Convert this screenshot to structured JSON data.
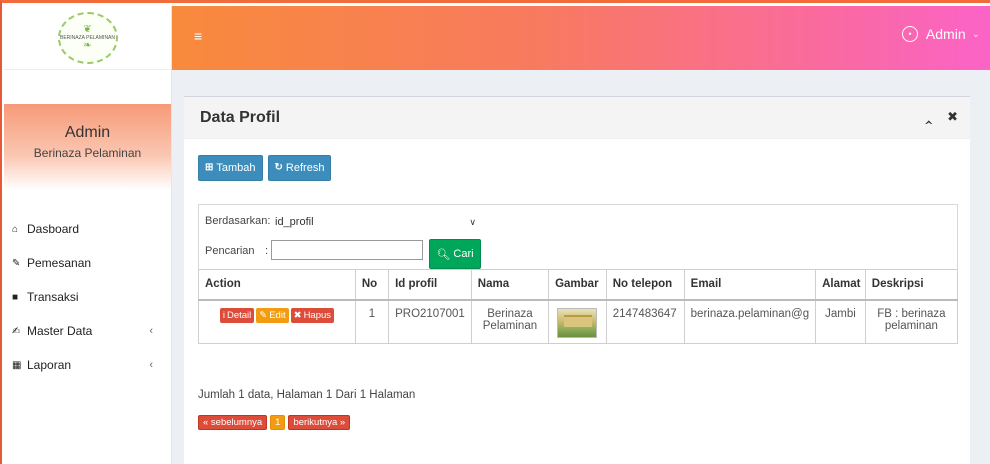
{
  "sidebar": {
    "logo_text": "BERINAZA PELAMINAN",
    "user_name": "Admin",
    "user_org": "Berinaza Pelaminan",
    "items": [
      {
        "label": "Dasboard"
      },
      {
        "label": "Pemesanan"
      },
      {
        "label": "Transaksi"
      },
      {
        "label": "Master Data"
      },
      {
        "label": "Laporan"
      }
    ]
  },
  "header": {
    "user_label": "Admin"
  },
  "box": {
    "title": "Data Profil",
    "btn_tambah": "Tambah",
    "btn_refresh": "Refresh"
  },
  "filter": {
    "by_label": "Berdasarkan:",
    "by_value": "id_profil",
    "search_label": "Pencarian",
    "search_colon": ":",
    "search_value": "",
    "btn_cari": "Cari"
  },
  "table": {
    "headers": [
      "Action",
      "No",
      "Id profil",
      "Nama",
      "Gambar",
      "No telepon",
      "Email",
      "Alamat",
      "Deskripsi"
    ],
    "actions": {
      "detail": "Detail",
      "edit": "Edit",
      "hapus": "Hapus"
    },
    "rows": [
      {
        "no": "1",
        "id_profil": "PRO2107001",
        "nama": "Berinaza Pelaminan",
        "no_telepon": "2147483647",
        "email": "berinaza.pelaminan@g",
        "alamat": "Jambi",
        "deskripsi": "FB : berinaza pelaminan"
      }
    ]
  },
  "summary": "Jumlah 1 data, Halaman 1 Dari 1 Halaman",
  "pager": {
    "prev": "« sebelumnya",
    "page": "1",
    "next": "berikutnya »"
  },
  "colors": {
    "header_start": "#f88a3c",
    "header_end": "#fb63c7",
    "primary": "#3c8dbc",
    "success": "#00a65a",
    "danger": "#dd4b39",
    "warning": "#f39c12"
  }
}
